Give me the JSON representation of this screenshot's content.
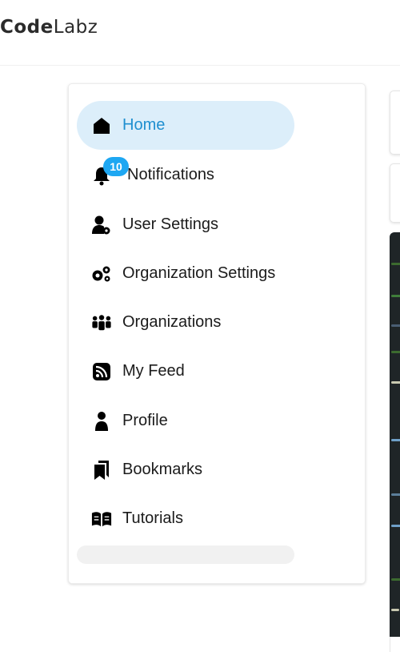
{
  "header": {
    "brand_prefix": "Code",
    "brand_suffix": "Labz"
  },
  "sidebar": {
    "items": [
      {
        "label": "Home",
        "icon": "home-icon",
        "active": true
      },
      {
        "label": "Notifications",
        "icon": "bell-icon",
        "badge": "10"
      },
      {
        "label": "User Settings",
        "icon": "user-settings-icon"
      },
      {
        "label": "Organization Settings",
        "icon": "gears-icon"
      },
      {
        "label": "Organizations",
        "icon": "people-group-icon"
      },
      {
        "label": "My Feed",
        "icon": "rss-feed-icon"
      },
      {
        "label": "Profile",
        "icon": "person-icon"
      },
      {
        "label": "Bookmarks",
        "icon": "bookmarks-icon"
      },
      {
        "label": "Tutorials",
        "icon": "open-book-icon"
      }
    ]
  },
  "colors": {
    "accent": "#1f8fd0",
    "active_bg": "#dceefa",
    "badge_bg": "#1ea7f2",
    "code_bg": "#1f2527"
  }
}
